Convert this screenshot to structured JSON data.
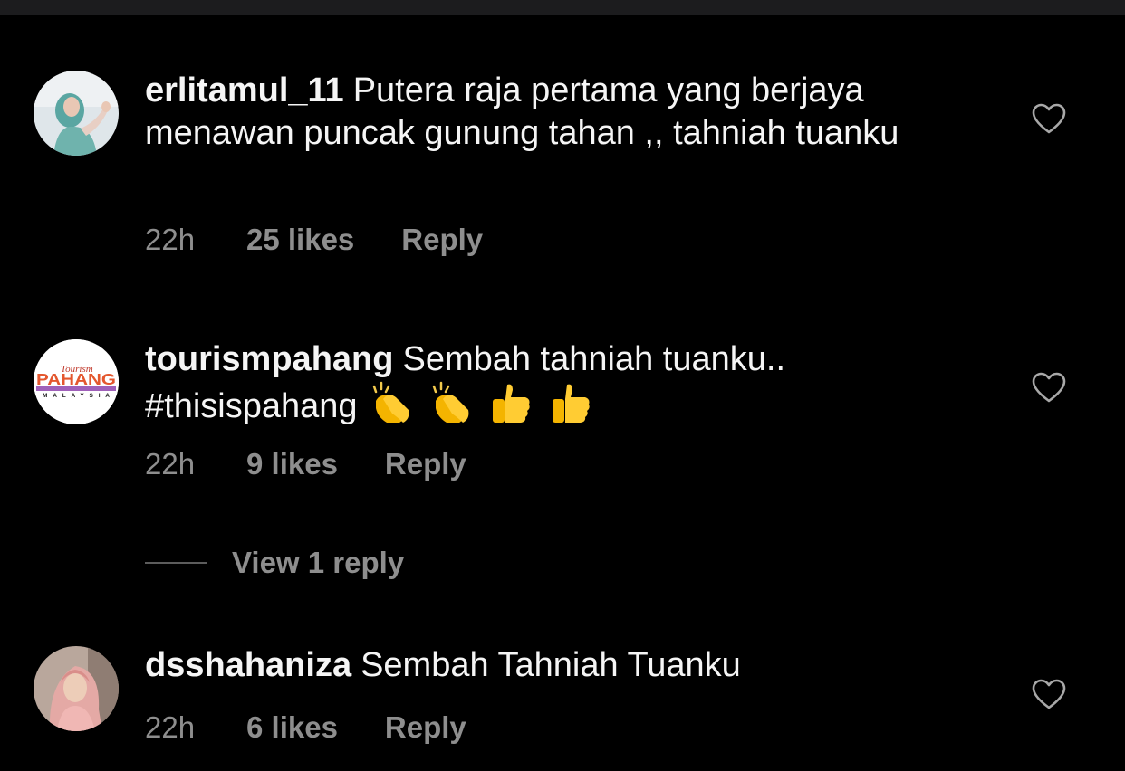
{
  "comments": [
    {
      "username": "erlitamul_11",
      "text": "Putera raja pertama yang berjaya menawan puncak gunung tahan ,, tahniah tuanku",
      "time": "22h",
      "likes": "25 likes",
      "reply": "Reply",
      "avatar_icon": "avatar-photo-woman-hijab",
      "liked": false
    },
    {
      "username": "tourismpahang",
      "text": "Sembah tahniah tuanku.. #thisispahang",
      "emojis": [
        "clapping-hands",
        "clapping-hands",
        "thumbs-up",
        "thumbs-up"
      ],
      "time": "22h",
      "likes": "9 likes",
      "reply": "Reply",
      "avatar_icon": "tourism-pahang-logo",
      "avatar_logo_text": {
        "script": "Tourism",
        "main": "PAHANG",
        "sub": "MALAYSIA"
      },
      "liked": false,
      "view_replies": "View 1 reply"
    },
    {
      "username": "dsshahaniza",
      "text": "Sembah Tahniah Tuanku",
      "time": "22h",
      "likes": "6 likes",
      "reply": "Reply",
      "avatar_icon": "avatar-photo-woman-pink-hijab",
      "liked": false
    }
  ],
  "colors": {
    "background": "#000000",
    "primary_text": "#f5f5f5",
    "secondary_text": "#8e8e8e",
    "divider": "#5c5c5c",
    "top_strip": "#1c1c1e"
  }
}
